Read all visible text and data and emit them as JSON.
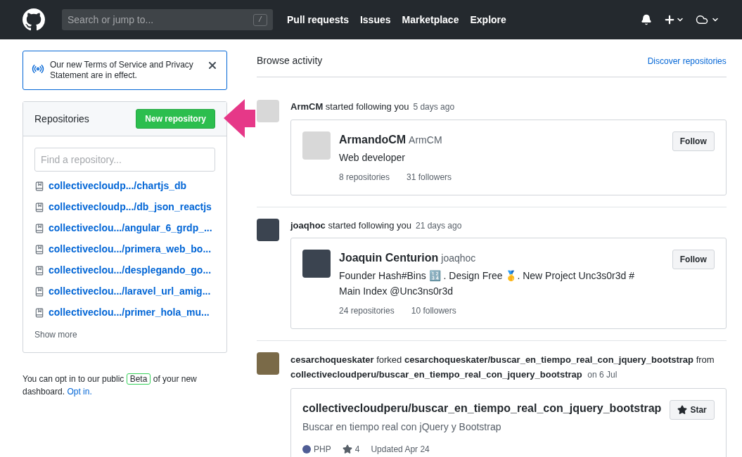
{
  "header": {
    "search_placeholder": "Search or jump to...",
    "search_key": "/",
    "nav": [
      "Pull requests",
      "Issues",
      "Marketplace",
      "Explore"
    ]
  },
  "notice": {
    "text": "Our new Terms of Service and Privacy Statement are in effect."
  },
  "repositories": {
    "title": "Repositories",
    "new_button": "New repository",
    "filter_placeholder": "Find a repository...",
    "items": [
      "collectivecloudp.../chartjs_db",
      "collectivecloudp.../db_json_reactjs",
      "collectiveclou.../angular_6_grdp_...",
      "collectiveclou.../primera_web_bo...",
      "collectiveclou.../desplegando_go...",
      "collectiveclou.../laravel_url_amig...",
      "collectiveclou.../primer_hola_mu..."
    ],
    "show_more": "Show more"
  },
  "beta": {
    "before": "You can opt in to our public",
    "badge": "Beta",
    "after": "of your new dashboard.",
    "link": "Opt in."
  },
  "feed": {
    "title": "Browse activity",
    "discover_link": "Discover repositories",
    "events": [
      {
        "kind": "follow",
        "actor": "ArmCM",
        "action": "started following you",
        "time": "5 days ago",
        "card": {
          "name": "ArmandoCM",
          "login": "ArmCM",
          "bio": "Web developer",
          "repos": "8 repositories",
          "followers": "31 followers",
          "button": "Follow"
        }
      },
      {
        "kind": "follow",
        "actor": "joaqhoc",
        "action": "started following you",
        "time": "21 days ago",
        "card": {
          "name": "Joaquin Centurion",
          "login": "joaqhoc",
          "bio": "Founder Hash#Bins 🔢 . Design Free 🥇. New Project Unc3s0r3d # Main Index @Unc3ns0r3d",
          "repos": "24 repositories",
          "followers": "10 followers",
          "button": "Follow"
        }
      },
      {
        "kind": "fork",
        "actor": "cesarchoqueskater",
        "action": "forked",
        "target": "cesarchoqueskater/buscar_en_tiempo_real_con_jquery_bootstrap",
        "joiner": "from",
        "source": "collectivecloudperu/buscar_en_tiempo_real_con_jquery_bootstrap",
        "time": "on 6 Jul",
        "card": {
          "repo": "collectivecloudperu/buscar_en_tiempo_real_con_jquery_bootstrap",
          "description": "Buscar en tiempo real con jQuery y Bootstrap",
          "language": "PHP",
          "color": "#4f5d95",
          "stars": "4",
          "updated": "Updated Apr 24",
          "button": "Star"
        }
      }
    ]
  }
}
